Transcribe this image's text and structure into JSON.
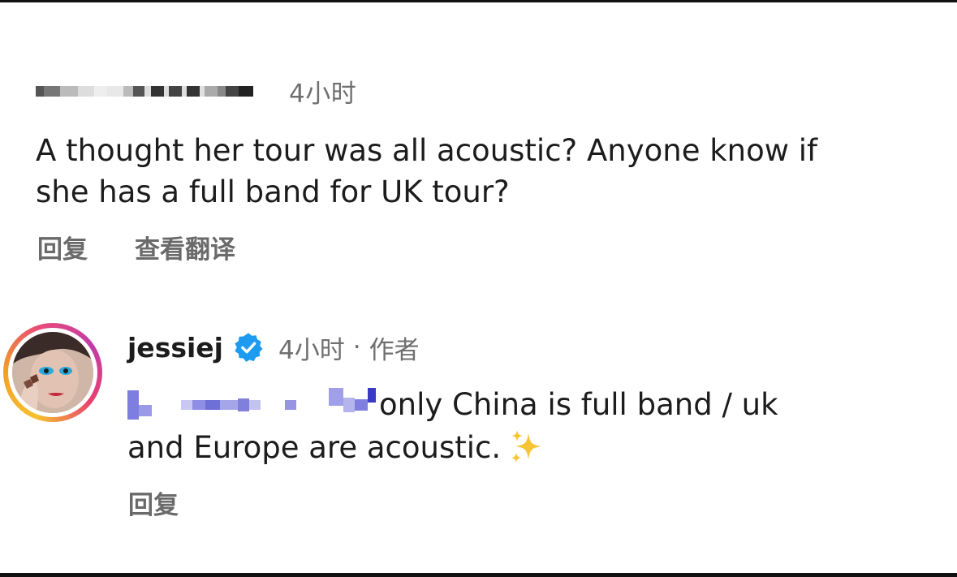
{
  "comment1": {
    "timestamp": "4小时",
    "text_line1": "A thought her tour was all acoustic? Anyone know if",
    "text_line2": "she has a full band for UK tour?",
    "reply_label": "回复",
    "translate_label": "查看翻译"
  },
  "comment2": {
    "username": "jessiej",
    "timestamp": "4小时",
    "separator": "·",
    "author_label": "作者",
    "text_line1": "only China is full band / uk",
    "text_line2": "and Europe are acoustic.",
    "reply_label": "回复"
  },
  "colors": {
    "verified_badge": "#1d9bf0",
    "meta_text": "#6f6f6f",
    "action_text": "#6a6a6a",
    "body_text": "#1c1c1c"
  },
  "icons": {
    "verified": "verified-badge-icon",
    "sparkles": "sparkles-emoji-icon",
    "avatar": "profile-avatar"
  }
}
